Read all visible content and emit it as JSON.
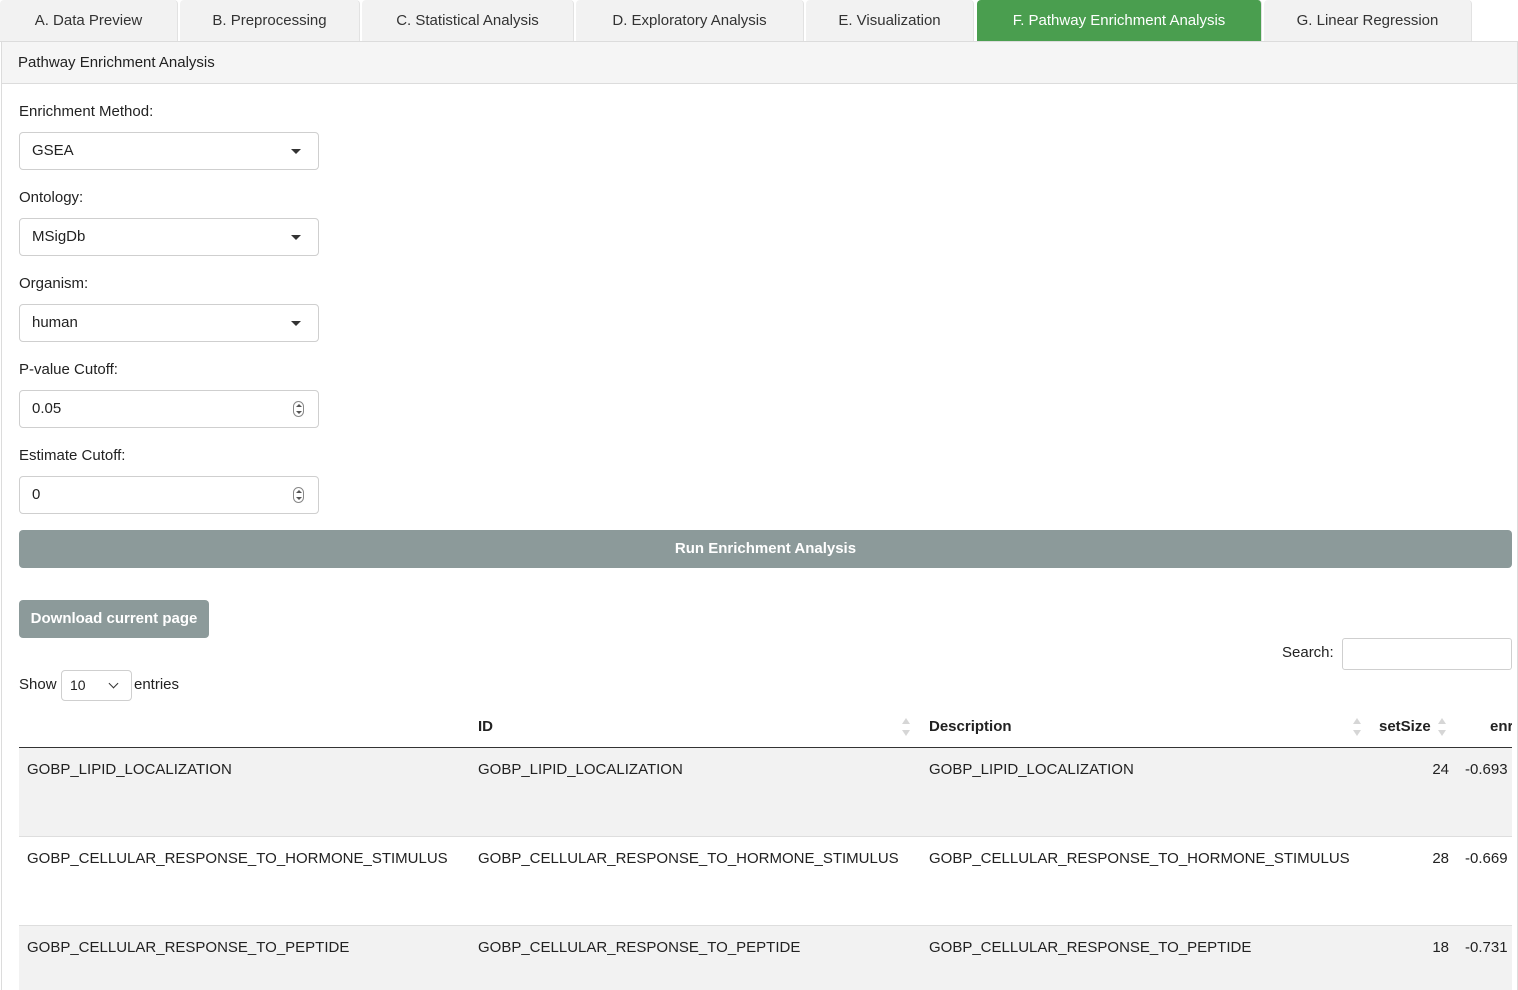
{
  "tabs": [
    {
      "label": "A. Data Preview"
    },
    {
      "label": "B. Preprocessing"
    },
    {
      "label": "C. Statistical Analysis"
    },
    {
      "label": "D. Exploratory Analysis"
    },
    {
      "label": "E. Visualization"
    },
    {
      "label": "F. Pathway Enrichment Analysis"
    },
    {
      "label": "G. Linear Regression"
    }
  ],
  "active_tab_color": "#4a9e4f",
  "panel": {
    "title": "Pathway Enrichment Analysis"
  },
  "form": {
    "method": {
      "label": "Enrichment Method:",
      "value": "GSEA"
    },
    "ontology": {
      "label": "Ontology:",
      "value": "MSigDb"
    },
    "organism": {
      "label": "Organism:",
      "value": "human"
    },
    "pvalue": {
      "label": "P-value Cutoff:",
      "value": "0.05"
    },
    "estimate": {
      "label": "Estimate Cutoff:",
      "value": "0"
    },
    "run_label": "Run Enrichment Analysis"
  },
  "button_color": "#8c9a9a",
  "download_label": "Download current page",
  "table": {
    "search_label": "Search:",
    "search_value": "",
    "show_label": "Show",
    "page_length": "10",
    "entries_label": "entries",
    "columns": [
      "",
      "ID",
      "Description",
      "setSize",
      "enr"
    ],
    "rows": [
      {
        "name": "GOBP_LIPID_LOCALIZATION",
        "id": "GOBP_LIPID_LOCALIZATION",
        "description": "GOBP_LIPID_LOCALIZATION",
        "setSize": "24",
        "enrichment": "-0.693"
      },
      {
        "name": "GOBP_CELLULAR_RESPONSE_TO_HORMONE_STIMULUS",
        "id": "GOBP_CELLULAR_RESPONSE_TO_HORMONE_STIMULUS",
        "description": "GOBP_CELLULAR_RESPONSE_TO_HORMONE_STIMULUS",
        "setSize": "28",
        "enrichment": "-0.669"
      },
      {
        "name": "GOBP_CELLULAR_RESPONSE_TO_PEPTIDE",
        "id": "GOBP_CELLULAR_RESPONSE_TO_PEPTIDE",
        "description": "GOBP_CELLULAR_RESPONSE_TO_PEPTIDE",
        "setSize": "18",
        "enrichment": "-0.731"
      }
    ]
  }
}
